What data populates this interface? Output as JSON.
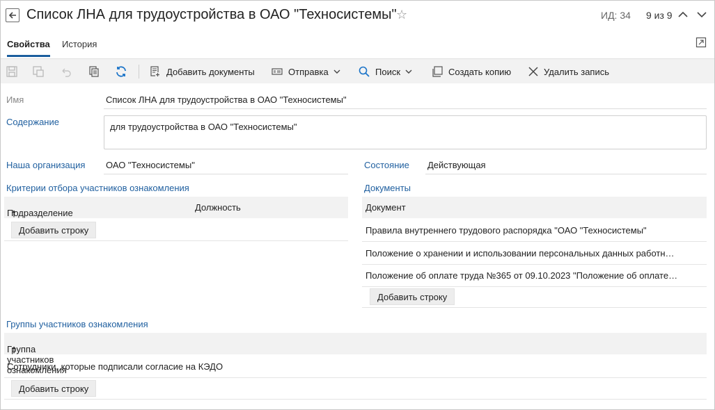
{
  "header": {
    "title": "Список ЛНА для трудоустройства в ОАО \"Техносистемы\"",
    "id_label": "ИД: 34",
    "counter": "9 из 9"
  },
  "tabs": [
    {
      "label": "Свойства",
      "active": true
    },
    {
      "label": "История",
      "active": false
    }
  ],
  "toolbar": {
    "add_documents": "Добавить документы",
    "send": "Отправка",
    "search": "Поиск",
    "create_copy": "Создать копию",
    "delete_record": "Удалить запись"
  },
  "form": {
    "name_label": "Имя",
    "name_value": "Список ЛНА для трудоустройства в ОАО \"Техносистемы\"",
    "content_label": "Содержание",
    "content_value": "для трудоустройства в ОАО \"Техносистемы\"",
    "org_label": "Наша организация",
    "org_value": "ОАО \"Техносистемы\"",
    "state_label": "Состояние",
    "state_value": "Действующая"
  },
  "criteria": {
    "title": "Критерии отбора участников ознакомления",
    "columns": [
      "Подразделение",
      "Должность"
    ],
    "add_row": "Добавить строку"
  },
  "documents": {
    "title": "Документы",
    "column": "Документ",
    "rows": [
      "Правила внутреннего трудового распорядка \"ОАО \"Техносистемы\"",
      "Положение о хранении и использовании персональных данных работн…",
      "Положение об оплате труда №365 от 09.10.2023 \"Положение об оплате…"
    ],
    "add_row": "Добавить строку"
  },
  "groups": {
    "title": "Группы участников ознакомления",
    "column": "Группа участников ознакомления",
    "rows": [
      "Сотрудники, которые подписали согласие на КЭДО"
    ],
    "add_row": "Добавить строку"
  },
  "colors": {
    "accent": "#1f5f9f",
    "refresh": "#1a73c8",
    "toolbar_bg": "#f2f2f2"
  }
}
